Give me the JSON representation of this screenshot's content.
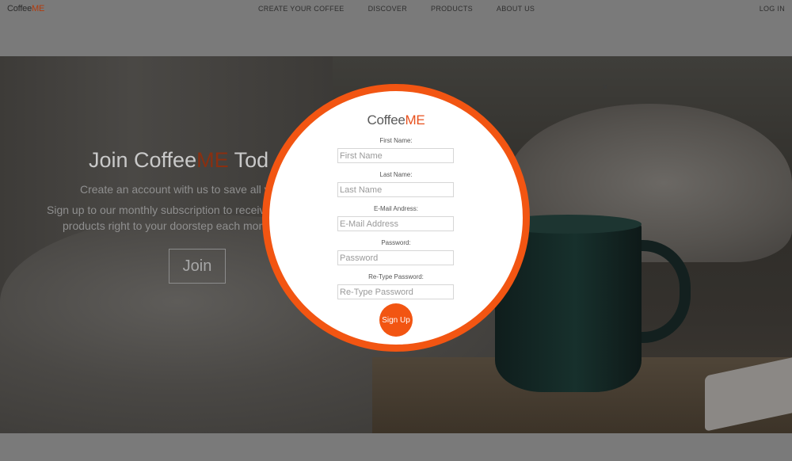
{
  "nav": {
    "brand_prefix": "Coffee",
    "brand_suffix": "ME",
    "links": [
      "CREATE YOUR COFFEE",
      "DISCOVER",
      "PRODUCTS",
      "ABOUT US"
    ],
    "login": "LOG IN"
  },
  "hero": {
    "headline_prefix": "Join Coffee",
    "headline_me": "ME",
    "headline_suffix": " Tod",
    "line1": "Create an account with us to save all yo",
    "line2": "Sign up to our monthly subscription to receive y",
    "line3": "products right to your doorstep each month",
    "join_label": "Join"
  },
  "modal": {
    "brand_prefix": "Coffee",
    "brand_suffix": "ME",
    "close_glyph": "×",
    "fields": [
      {
        "label": "First Name:",
        "placeholder": "First Name"
      },
      {
        "label": "Last Name:",
        "placeholder": "Last Name"
      },
      {
        "label": "E-Mail Andress:",
        "placeholder": "E-Mail Address"
      },
      {
        "label": "Password:",
        "placeholder": "Password"
      },
      {
        "label": "Re-Type Password:",
        "placeholder": "Re-Type Password"
      }
    ],
    "signup_label": "Sign Up"
  },
  "colors": {
    "accent": "#f25512",
    "overlay": "#7a7a7a"
  }
}
